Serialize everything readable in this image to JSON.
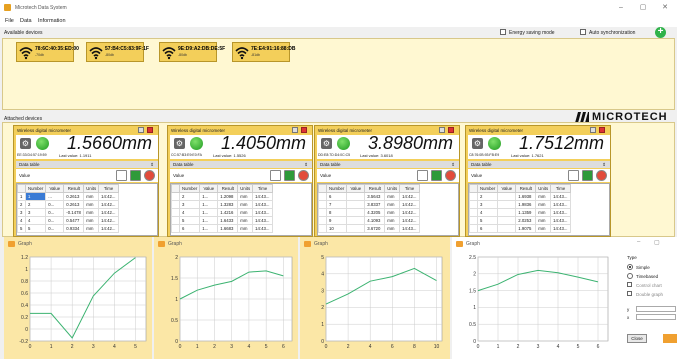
{
  "window": {
    "title": "Microtech Data System"
  },
  "menu": [
    "File",
    "Data",
    "Information"
  ],
  "available": {
    "label": "Available devices",
    "energy_saving": "Energy saving mode",
    "auto_sync": "Auto synchronization",
    "devices": [
      {
        "mac": "78:6C:40:35:ED:00",
        "rssi": "-70db"
      },
      {
        "mac": "57:B4:C5:83:9F:1F",
        "rssi": "-80db"
      },
      {
        "mac": "9E:D9:A2:DB:DE:5F",
        "rssi": "-80db"
      },
      {
        "mac": "7E:E4:91:16:88:DB",
        "rssi": "-81db"
      }
    ]
  },
  "attached": {
    "label": "Attached devices"
  },
  "brand": "MICROTECH",
  "cards": [
    {
      "title": "Wireless digital micrometer",
      "reading": "1.5660mm",
      "addr": "EE:33:D4:57:19:59",
      "last_label": "Last value:",
      "last_value": "1.1911",
      "rows": [
        [
          "1",
          "1",
          "...",
          "0.2613",
          "mm",
          "14:42..."
        ],
        [
          "2",
          "2",
          "0...",
          "0.2613",
          "mm",
          "14:42..."
        ],
        [
          "3",
          "3",
          "0...",
          "-0.1478",
          "mm",
          "14:42..."
        ],
        [
          "4",
          "4",
          "0...",
          "0.5477",
          "mm",
          "14:42..."
        ],
        [
          "5",
          "5",
          "0...",
          "0.9334",
          "mm",
          "14:42..."
        ]
      ]
    },
    {
      "title": "Wireless digital micrometer",
      "reading": "1.4050mm",
      "addr": "CC:57:B3:E9:E0:FA",
      "last_label": "Last value:",
      "last_value": "1.5526",
      "rows": [
        [
          "",
          "2",
          "1...",
          "1.2098",
          "mm",
          "14:43..."
        ],
        [
          "",
          "3",
          "1...",
          "1.3283",
          "mm",
          "14:43..."
        ],
        [
          "",
          "4",
          "1...",
          "1.4216",
          "mm",
          "14:43..."
        ],
        [
          "",
          "5",
          "1...",
          "1.6433",
          "mm",
          "14:43..."
        ],
        [
          "",
          "6",
          "1...",
          "1.6683",
          "mm",
          "14:43..."
        ]
      ]
    },
    {
      "title": "Wireless digital micrometer",
      "reading": "3.8980mm",
      "addr": "DD:E8:7D:D4:0C:C5",
      "last_label": "Last value:",
      "last_value": "3.6018",
      "rows": [
        [
          "",
          "6",
          "",
          "3.5643",
          "mm",
          "14:42..."
        ],
        [
          "",
          "7",
          "",
          "3.8337",
          "mm",
          "14:42..."
        ],
        [
          "",
          "8",
          "",
          "4.3205",
          "mm",
          "14:42..."
        ],
        [
          "",
          "9",
          "",
          "4.1093",
          "mm",
          "14:42..."
        ],
        [
          "",
          "10",
          "",
          "3.6720",
          "mm",
          "14:43..."
        ]
      ]
    },
    {
      "title": "Wireless digital micrometer",
      "reading": "1.7512mm",
      "addr": "C8:76:0B:93:FB:E9",
      "last_label": "Last value:",
      "last_value": "1.7621",
      "rows": [
        [
          "",
          "2",
          "",
          "1.6938",
          "mm",
          "14:43..."
        ],
        [
          "",
          "3",
          "",
          "1.9836",
          "mm",
          "14:43..."
        ],
        [
          "",
          "4",
          "",
          "1.1359",
          "mm",
          "14:43..."
        ],
        [
          "",
          "5",
          "",
          "2.0253",
          "mm",
          "14:43..."
        ],
        [
          "",
          "6",
          "",
          "1.9075",
          "mm",
          "14:43..."
        ]
      ]
    }
  ],
  "table_headers": [
    "",
    "Number",
    "Value",
    "Result",
    "Units",
    "Time"
  ],
  "data_table_label": "Data table",
  "value_label": "Value",
  "graph_title": "Graph",
  "type_panel": {
    "title": "Type",
    "options": [
      "Simple",
      "Timebased",
      "Control chart",
      "Double graph"
    ],
    "selected": "Simple",
    "y_label": "y",
    "x_label": "x",
    "close": "Close"
  },
  "chart_data": [
    {
      "type": "line",
      "x": [
        0,
        1,
        2,
        3,
        4,
        5,
        6
      ],
      "y": [
        0.26,
        0.26,
        -0.15,
        0.55,
        0.93,
        1.19,
        1.19
      ],
      "xlim": [
        0,
        5.5
      ],
      "ylim": [
        -0.2,
        1.2
      ],
      "yticks": [
        -0.2,
        0,
        0.2,
        0.4,
        0.6,
        0.8,
        1,
        1.2
      ],
      "xticks": [
        0,
        1,
        2,
        3,
        4,
        5
      ],
      "grid": true
    },
    {
      "type": "line",
      "x": [
        0,
        1,
        2,
        3,
        4,
        5,
        6
      ],
      "y": [
        1.0,
        1.21,
        1.33,
        1.42,
        1.64,
        1.67,
        1.55
      ],
      "xlim": [
        0,
        6.5
      ],
      "ylim": [
        0,
        2
      ],
      "yticks": [
        0,
        0.5,
        1,
        1.5,
        2
      ],
      "xticks": [
        0,
        1,
        2,
        3,
        4,
        5,
        6
      ],
      "grid": true
    },
    {
      "type": "line",
      "x": [
        0,
        2,
        4,
        6,
        8,
        10
      ],
      "y": [
        2.2,
        2.8,
        3.56,
        3.83,
        4.32,
        3.6
      ],
      "xlim": [
        0,
        10.5
      ],
      "ylim": [
        0,
        5
      ],
      "yticks": [
        0,
        1,
        2,
        3,
        4,
        5
      ],
      "xticks": [
        0,
        2,
        4,
        6,
        8,
        10
      ],
      "grid": true
    },
    {
      "type": "line",
      "x": [
        0,
        1,
        2,
        3,
        4,
        5,
        6
      ],
      "y": [
        1.5,
        1.69,
        1.98,
        2.1,
        2.03,
        1.9,
        1.76
      ],
      "xlim": [
        0,
        6.5
      ],
      "ylim": [
        0,
        2.5
      ],
      "yticks": [
        0,
        0.5,
        1,
        1.5,
        2,
        2.5
      ],
      "xticks": [
        0,
        1,
        2,
        3,
        4,
        5,
        6
      ],
      "grid": true
    }
  ]
}
